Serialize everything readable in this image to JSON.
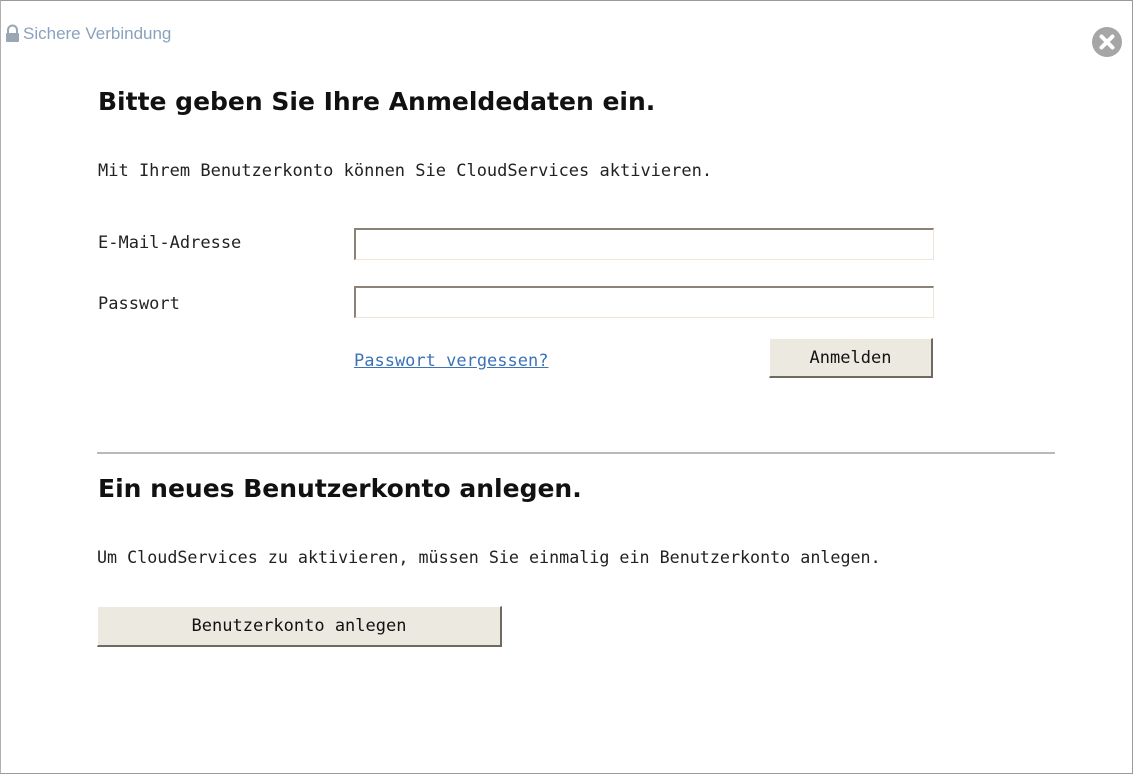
{
  "secure_bar": {
    "icon": "lock-icon",
    "text": "Sichere Verbindung"
  },
  "close": {
    "icon": "close-icon"
  },
  "login": {
    "heading": "Bitte geben Sie Ihre Anmeldedaten ein.",
    "intro": "Mit Ihrem Benutzerkonto können Sie CloudServices aktivieren.",
    "email_label": "E-Mail-Adresse",
    "email_value": "",
    "password_label": "Passwort",
    "password_value": "",
    "forgot_link": "Passwort vergessen?",
    "submit_label": "Anmelden"
  },
  "register": {
    "heading": "Ein neues Benutzerkonto anlegen.",
    "intro": "Um CloudServices zu aktivieren, müssen Sie einmalig ein Benutzerkonto anlegen.",
    "button_label": "Benutzerkonto anlegen"
  },
  "colors": {
    "link": "#3b73b9",
    "secure_text": "#8aa2be",
    "button_face": "#ece9e1",
    "close_button": "#a6a6a6",
    "divider": "#b9b9b9"
  }
}
